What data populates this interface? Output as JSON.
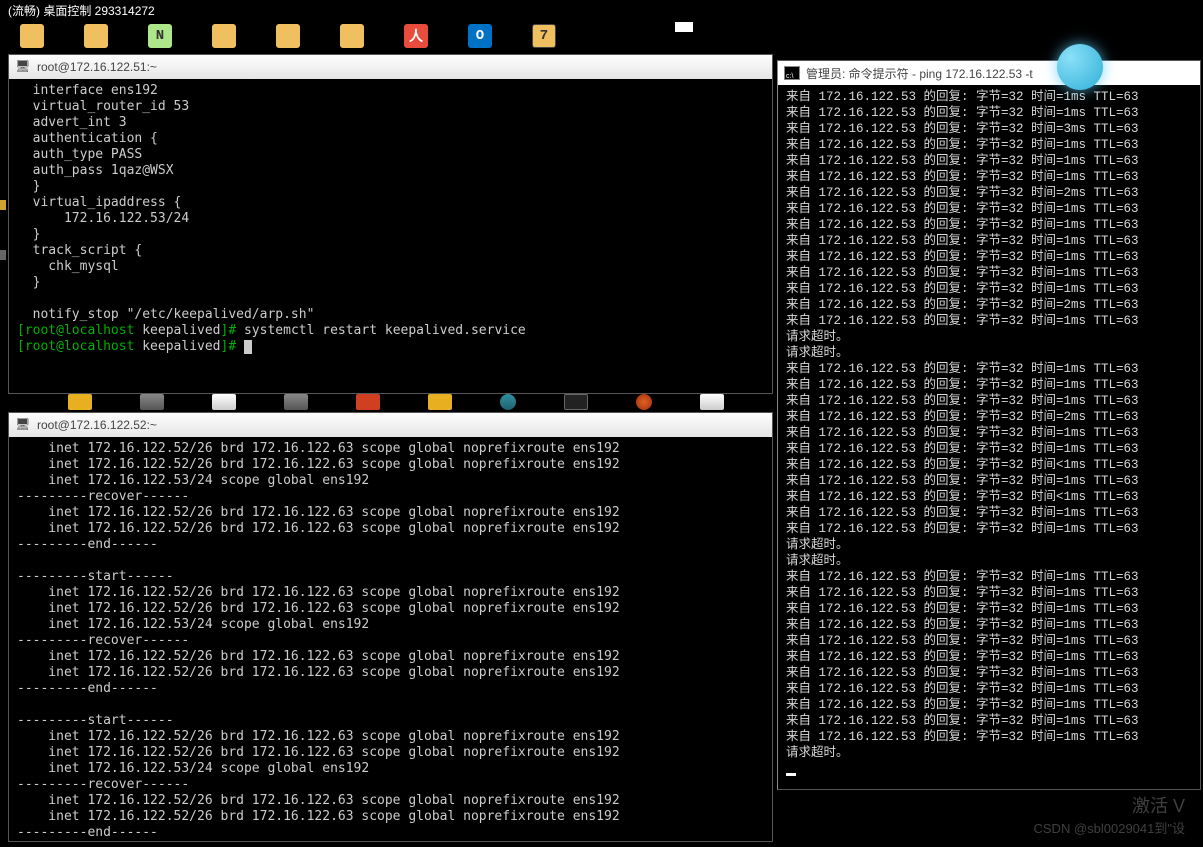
{
  "remote": {
    "title": "(流畅) 桌面控制 293314272"
  },
  "terminal1": {
    "title": "root@172.16.122.51:~",
    "config_lines": [
      "  interface ens192",
      "  virtual_router_id 53",
      "  advert_int 3",
      "  authentication {",
      "  auth_type PASS",
      "  auth_pass 1qaz@WSX",
      "  }",
      "  virtual_ipaddress {",
      "      172.16.122.53/24",
      "  }",
      "  track_script {",
      "    chk_mysql",
      "  }",
      "",
      "  notify_stop \"/etc/keepalived/arp.sh\""
    ],
    "prompt1_user": "root@localhost",
    "prompt1_path": "keepalived",
    "prompt1_cmd": "systemctl restart keepalived.service",
    "prompt2_user": "root@localhost",
    "prompt2_path": "keepalived"
  },
  "terminal2": {
    "title": "root@172.16.122.52:~",
    "lines": [
      "    inet 172.16.122.52/26 brd 172.16.122.63 scope global noprefixroute ens192",
      "    inet 172.16.122.52/26 brd 172.16.122.63 scope global noprefixroute ens192",
      "    inet 172.16.122.53/24 scope global ens192",
      "---------recover------",
      "    inet 172.16.122.52/26 brd 172.16.122.63 scope global noprefixroute ens192",
      "    inet 172.16.122.52/26 brd 172.16.122.63 scope global noprefixroute ens192",
      "---------end------",
      "",
      "---------start------",
      "    inet 172.16.122.52/26 brd 172.16.122.63 scope global noprefixroute ens192",
      "    inet 172.16.122.52/26 brd 172.16.122.63 scope global noprefixroute ens192",
      "    inet 172.16.122.53/24 scope global ens192",
      "---------recover------",
      "    inet 172.16.122.52/26 brd 172.16.122.63 scope global noprefixroute ens192",
      "    inet 172.16.122.52/26 brd 172.16.122.63 scope global noprefixroute ens192",
      "---------end------",
      "",
      "---------start------",
      "    inet 172.16.122.52/26 brd 172.16.122.63 scope global noprefixroute ens192",
      "    inet 172.16.122.52/26 brd 172.16.122.63 scope global noprefixroute ens192",
      "    inet 172.16.122.53/24 scope global ens192",
      "---------recover------",
      "    inet 172.16.122.52/26 brd 172.16.122.63 scope global noprefixroute ens192",
      "    inet 172.16.122.52/26 brd 172.16.122.63 scope global noprefixroute ens192",
      "---------end------",
      ""
    ]
  },
  "cmd": {
    "title": "管理员: 命令提示符 - ping   172.16.122.53 -t",
    "lines": [
      "来自 172.16.122.53 的回复: 字节=32 时间=1ms TTL=63",
      "来自 172.16.122.53 的回复: 字节=32 时间=1ms TTL=63",
      "来自 172.16.122.53 的回复: 字节=32 时间=3ms TTL=63",
      "来自 172.16.122.53 的回复: 字节=32 时间=1ms TTL=63",
      "来自 172.16.122.53 的回复: 字节=32 时间=1ms TTL=63",
      "来自 172.16.122.53 的回复: 字节=32 时间=1ms TTL=63",
      "来自 172.16.122.53 的回复: 字节=32 时间=2ms TTL=63",
      "来自 172.16.122.53 的回复: 字节=32 时间=1ms TTL=63",
      "来自 172.16.122.53 的回复: 字节=32 时间=1ms TTL=63",
      "来自 172.16.122.53 的回复: 字节=32 时间=1ms TTL=63",
      "来自 172.16.122.53 的回复: 字节=32 时间=1ms TTL=63",
      "来自 172.16.122.53 的回复: 字节=32 时间=1ms TTL=63",
      "来自 172.16.122.53 的回复: 字节=32 时间=1ms TTL=63",
      "来自 172.16.122.53 的回复: 字节=32 时间=2ms TTL=63",
      "来自 172.16.122.53 的回复: 字节=32 时间=1ms TTL=63",
      "请求超时。",
      "请求超时。",
      "来自 172.16.122.53 的回复: 字节=32 时间=1ms TTL=63",
      "来自 172.16.122.53 的回复: 字节=32 时间=1ms TTL=63",
      "来自 172.16.122.53 的回复: 字节=32 时间=1ms TTL=63",
      "来自 172.16.122.53 的回复: 字节=32 时间=2ms TTL=63",
      "来自 172.16.122.53 的回复: 字节=32 时间=1ms TTL=63",
      "来自 172.16.122.53 的回复: 字节=32 时间=1ms TTL=63",
      "来自 172.16.122.53 的回复: 字节=32 时间<1ms TTL=63",
      "来自 172.16.122.53 的回复: 字节=32 时间=1ms TTL=63",
      "来自 172.16.122.53 的回复: 字节=32 时间<1ms TTL=63",
      "来自 172.16.122.53 的回复: 字节=32 时间=1ms TTL=63",
      "来自 172.16.122.53 的回复: 字节=32 时间=1ms TTL=63",
      "请求超时。",
      "请求超时。",
      "来自 172.16.122.53 的回复: 字节=32 时间=1ms TTL=63",
      "来自 172.16.122.53 的回复: 字节=32 时间=1ms TTL=63",
      "来自 172.16.122.53 的回复: 字节=32 时间=1ms TTL=63",
      "来自 172.16.122.53 的回复: 字节=32 时间=1ms TTL=63",
      "来自 172.16.122.53 的回复: 字节=32 时间=1ms TTL=63",
      "来自 172.16.122.53 的回复: 字节=32 时间=1ms TTL=63",
      "来自 172.16.122.53 的回复: 字节=32 时间=1ms TTL=63",
      "来自 172.16.122.53 的回复: 字节=32 时间=1ms TTL=63",
      "来自 172.16.122.53 的回复: 字节=32 时间=1ms TTL=63",
      "来自 172.16.122.53 的回复: 字节=32 时间=1ms TTL=63",
      "来自 172.16.122.53 的回复: 字节=32 时间=1ms TTL=63",
      "请求超时。"
    ]
  },
  "watermark": {
    "line1": "激活 V",
    "line2": "CSDN @sbl0029041到\"设"
  }
}
